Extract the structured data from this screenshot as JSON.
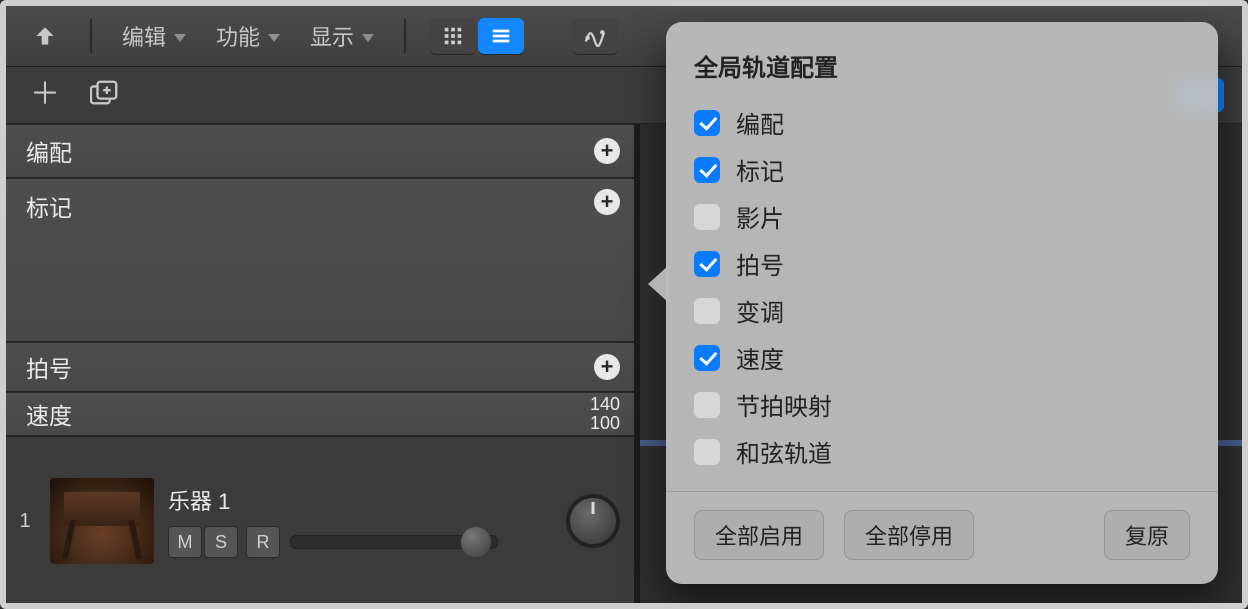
{
  "toolbar": {
    "menus": [
      "编辑",
      "功能",
      "显示"
    ]
  },
  "globalTracks": {
    "arrange": "编配",
    "marker": "标记",
    "signature": "拍号",
    "tempo": "速度",
    "tempoHigh": "140",
    "tempoLow": "100"
  },
  "track": {
    "index": "1",
    "name": "乐器 1",
    "mute": "M",
    "solo": "S",
    "record": "R"
  },
  "popover": {
    "title": "全局轨道配置",
    "items": [
      {
        "label": "编配",
        "checked": true
      },
      {
        "label": "标记",
        "checked": true
      },
      {
        "label": "影片",
        "checked": false
      },
      {
        "label": "拍号",
        "checked": true
      },
      {
        "label": "变调",
        "checked": false
      },
      {
        "label": "速度",
        "checked": true
      },
      {
        "label": "节拍映射",
        "checked": false
      },
      {
        "label": "和弦轨道",
        "checked": false
      }
    ],
    "enableAll": "全部启用",
    "disableAll": "全部停用",
    "revert": "复原"
  }
}
